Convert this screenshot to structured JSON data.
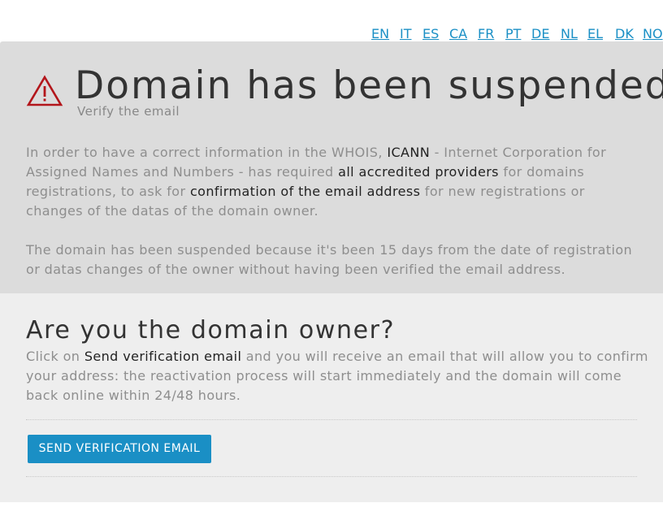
{
  "languages": [
    "EN",
    "IT",
    "ES",
    "CA",
    "FR",
    "PT",
    "DE",
    "NL",
    "EL",
    "DK",
    "NO"
  ],
  "notice": {
    "icon": "warning-triangle-icon",
    "title": "Domain has been suspended",
    "subtitle": "Verify the email",
    "p1": {
      "t1": "In order to have a correct information in the WHOIS, ",
      "b1": "ICANN",
      "t2": " - Internet Corporation for Assigned Names and Numbers - has required ",
      "b2": "all accredited providers",
      "t3": " for domains registrations, to ask for ",
      "b3": "confirmation of the email address",
      "t4": " for new registrations or changes of the datas of the domain owner."
    },
    "p2": "The domain has been suspended because it's been 15 days from the date of registration or datas changes of the owner without having been verified the email address."
  },
  "owner": {
    "heading": "Are you the domain owner?",
    "p": {
      "t1": "Click on ",
      "b1": "Send verification email",
      "t2": " and you will receive an email that will allow you to confirm your address: the reactivation process will start immediately and the domain will come back online within 24/48 hours."
    },
    "button_label": "SEND VERIFICATION EMAIL"
  },
  "colors": {
    "accent": "#1a8fc5",
    "warning": "#b3161b",
    "top_panel_bg": "#dcdcdc",
    "bottom_panel_bg": "#eeeeee"
  }
}
